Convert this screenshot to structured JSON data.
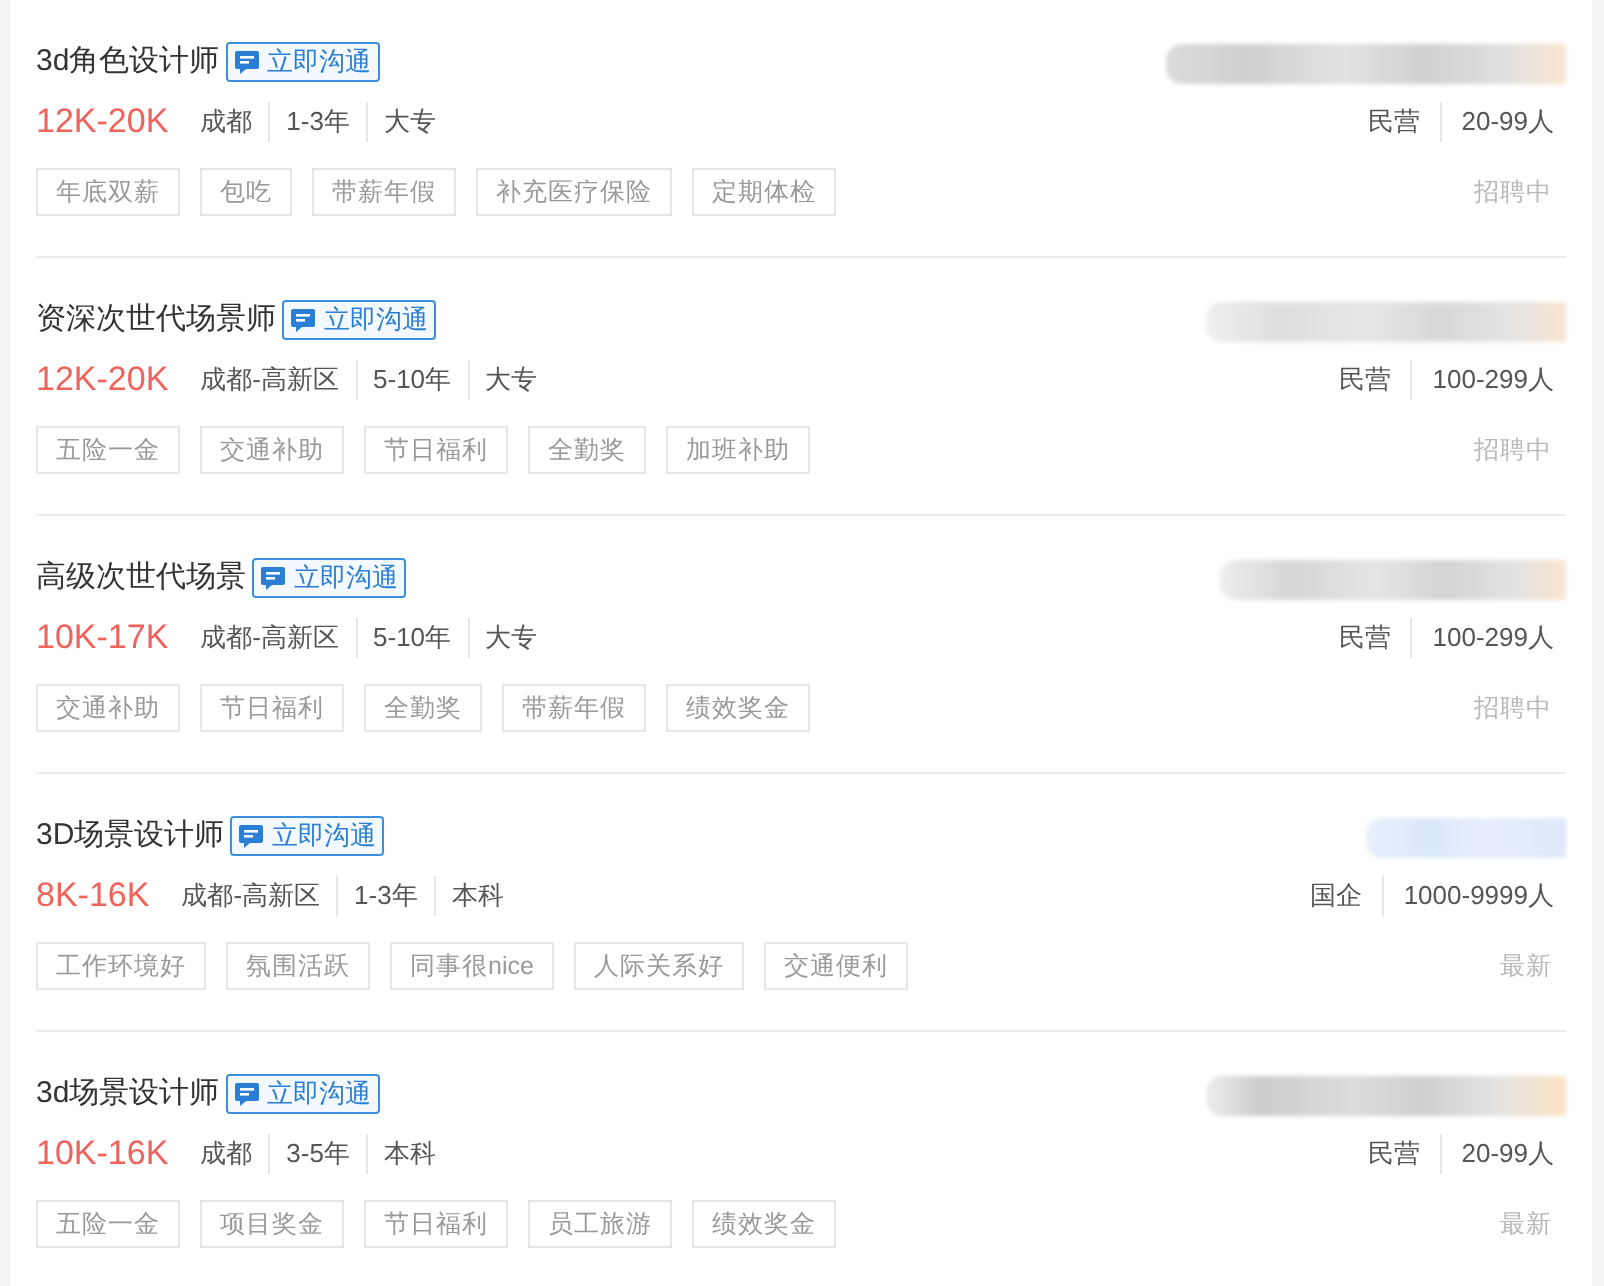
{
  "jobs": [
    {
      "title": "3d角色设计师",
      "chat_button": "立即沟通",
      "salary": "12K-20K",
      "details": [
        "成都",
        "1-3年",
        "大专"
      ],
      "company_details": [
        "民营",
        "20-99人"
      ],
      "benefits": [
        "年底双薪",
        "包吃",
        "带薪年假",
        "补充医疗保险",
        "定期体检"
      ],
      "status": "招聘中"
    },
    {
      "title": "资深次世代场景师",
      "chat_button": "立即沟通",
      "salary": "12K-20K",
      "details": [
        "成都-高新区",
        "5-10年",
        "大专"
      ],
      "company_details": [
        "民营",
        "100-299人"
      ],
      "benefits": [
        "五险一金",
        "交通补助",
        "节日福利",
        "全勤奖",
        "加班补助"
      ],
      "status": "招聘中"
    },
    {
      "title": "高级次世代场景",
      "chat_button": "立即沟通",
      "salary": "10K-17K",
      "details": [
        "成都-高新区",
        "5-10年",
        "大专"
      ],
      "company_details": [
        "民营",
        "100-299人"
      ],
      "benefits": [
        "交通补助",
        "节日福利",
        "全勤奖",
        "带薪年假",
        "绩效奖金"
      ],
      "status": "招聘中"
    },
    {
      "title": "3D场景设计师",
      "chat_button": "立即沟通",
      "salary": "8K-16K",
      "details": [
        "成都-高新区",
        "1-3年",
        "本科"
      ],
      "company_details": [
        "国企",
        "1000-9999人"
      ],
      "benefits": [
        "工作环境好",
        "氛围活跃",
        "同事很nice",
        "人际关系好",
        "交通便利"
      ],
      "status": "最新"
    },
    {
      "title": "3d场景设计师",
      "chat_button": "立即沟通",
      "salary": "10K-16K",
      "details": [
        "成都",
        "3-5年",
        "本科"
      ],
      "company_details": [
        "民营",
        "20-99人"
      ],
      "benefits": [
        "五险一金",
        "项目奖金",
        "节日福利",
        "员工旅游",
        "绩效奖金"
      ],
      "status": "最新"
    }
  ]
}
